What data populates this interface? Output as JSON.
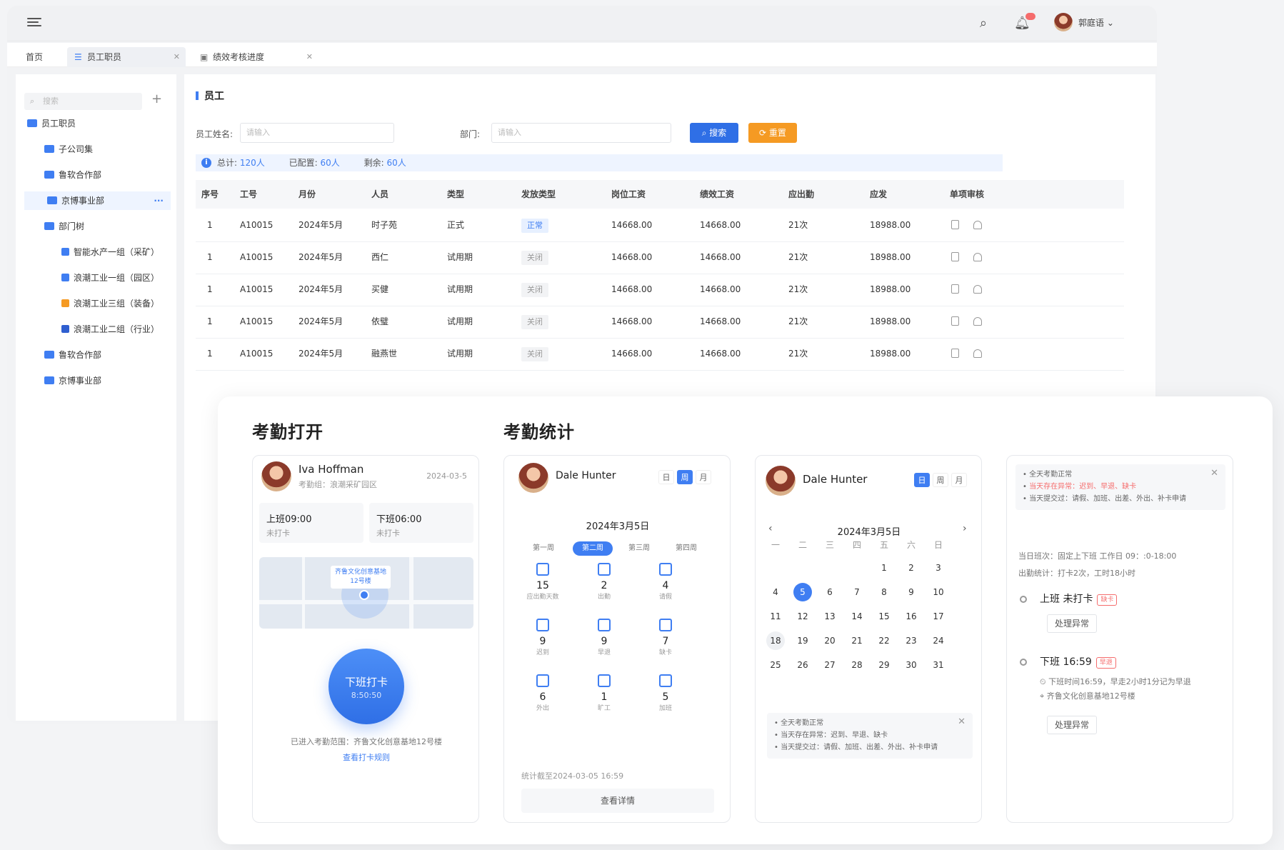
{
  "header": {
    "user_name": "郭庭语"
  },
  "tabs": [
    {
      "label": "首页"
    },
    {
      "label": "员工职员"
    },
    {
      "label": "绩效考核进度"
    }
  ],
  "sidebar": {
    "search_placeholder": "搜索",
    "items": [
      {
        "label": "员工职员"
      },
      {
        "label": "子公司集"
      },
      {
        "label": "鲁软合作部"
      },
      {
        "label": "京博事业部"
      },
      {
        "label": "部门树"
      },
      {
        "label": "智能水产一组（采矿）"
      },
      {
        "label": "浪潮工业一组（园区）"
      },
      {
        "label": "浪潮工业三组（装备）"
      },
      {
        "label": "浪潮工业二组（行业）"
      },
      {
        "label": "鲁软合作部"
      },
      {
        "label": "京博事业部"
      }
    ]
  },
  "main": {
    "title": "员工",
    "name_label": "员工姓名:",
    "name_placeholder": "请输入",
    "dept_label": "部门:",
    "dept_placeholder": "请输入",
    "search_btn": "搜索",
    "reset_btn": "重置",
    "total_label": "总计:",
    "total": "120人",
    "assigned_label": "已配置:",
    "assigned": "60人",
    "remain_label": "剩余:",
    "remain": "60人",
    "columns": [
      "序号",
      "工号",
      "月份",
      "人员",
      "类型",
      "发放类型",
      "岗位工资",
      "绩效工资",
      "应出勤",
      "应发",
      "单项审核"
    ],
    "rows": [
      {
        "no": "1",
        "id": "A10015",
        "month": "2024年5月",
        "name": "时子苑",
        "type": "正式",
        "pay": "正常",
        "base": "14668.00",
        "perf": "14668.00",
        "att": "21次",
        "total": "18988.00"
      },
      {
        "no": "1",
        "id": "A10015",
        "month": "2024年5月",
        "name": "西仁",
        "type": "试用期",
        "pay": "关闭",
        "base": "14668.00",
        "perf": "14668.00",
        "att": "21次",
        "total": "18988.00"
      },
      {
        "no": "1",
        "id": "A10015",
        "month": "2024年5月",
        "name": "买健",
        "type": "试用期",
        "pay": "关闭",
        "base": "14668.00",
        "perf": "14668.00",
        "att": "21次",
        "total": "18988.00"
      },
      {
        "no": "1",
        "id": "A10015",
        "month": "2024年5月",
        "name": "依璧",
        "type": "试用期",
        "pay": "关闭",
        "base": "14668.00",
        "perf": "14668.00",
        "att": "21次",
        "total": "18988.00"
      },
      {
        "no": "1",
        "id": "A10015",
        "month": "2024年5月",
        "name": "融燕世",
        "type": "试用期",
        "pay": "关闭",
        "base": "14668.00",
        "perf": "14668.00",
        "att": "21次",
        "total": "18988.00"
      }
    ]
  },
  "panel": {
    "title_left": "考勤打开",
    "title_right": "考勤统计",
    "card1": {
      "name": "Iva Hoffman",
      "date": "2024-03-5",
      "group": "考勤组：浪潮采矿园区",
      "on": "上班09:00",
      "on_s": "未打卡",
      "off": "下班06:00",
      "off_s": "未打卡",
      "map_label": "齐鲁文化创意基地\n12号楼",
      "btn": "下班打卡",
      "btn_time": "8:50:50",
      "range": "已进入考勤范围：齐鲁文化创意基地12号楼",
      "rule_link": "查看打卡规则"
    },
    "card2": {
      "name": "Dale Hunter",
      "seg": [
        "日",
        "周",
        "月"
      ],
      "date": "2024年3月5日",
      "weeks": [
        "第一周",
        "第二周",
        "第三周",
        "第四周"
      ],
      "stats": [
        {
          "v": "15",
          "t": "应出勤天数"
        },
        {
          "v": "2",
          "t": "出勤"
        },
        {
          "v": "4",
          "t": "请假"
        },
        {
          "v": "9",
          "t": "迟到"
        },
        {
          "v": "9",
          "t": "早退"
        },
        {
          "v": "7",
          "t": "缺卡"
        },
        {
          "v": "6",
          "t": "外出"
        },
        {
          "v": "1",
          "t": "旷工"
        },
        {
          "v": "5",
          "t": "加班"
        }
      ],
      "footer": "统计截至2024-03-05 16:59",
      "detail": "查看详情"
    },
    "card3": {
      "name": "Dale Hunter",
      "seg": [
        "日",
        "周",
        "月"
      ],
      "date": "2024年3月5日",
      "weekdays": [
        "一",
        "二",
        "三",
        "四",
        "五",
        "六",
        "日"
      ],
      "days": [
        "",
        "",
        "",
        "",
        "1",
        "2",
        "3",
        "4",
        "5",
        "6",
        "7",
        "8",
        "9",
        "10",
        "11",
        "12",
        "13",
        "14",
        "15",
        "16",
        "17",
        "18",
        "19",
        "20",
        "21",
        "22",
        "23",
        "24",
        "25",
        "26",
        "27",
        "28",
        "29",
        "30",
        "31"
      ],
      "notes": [
        "全天考勤正常",
        "当天存在异常：迟到、早退、缺卡",
        "当天提交过：请假、加班、出差、外出、补卡申请"
      ]
    },
    "card4": {
      "notes": [
        "全天考勤正常",
        "当天存在异常：迟到、早退、缺卡",
        "当天提交过：请假、加班、出差、外出、补卡申请"
      ],
      "shift": "当日班次：固定上下班 工作日 09：:0-18:00",
      "summary": "出勤统计：打卡2次，工时18小时",
      "on_title": "上班 未打卡",
      "on_tag": "缺卡",
      "handle": "处理异常",
      "off_title": "下班 16:59",
      "off_tag": "早退",
      "off_d1": "下班时间16:59，早走2小时1分记为早退",
      "off_d2": "齐鲁文化创意基地12号楼",
      "handle2": "处理异常"
    }
  },
  "colors": {
    "accent": "#3f7ef2",
    "orange": "#f59a23",
    "red": "#f56c6c"
  }
}
